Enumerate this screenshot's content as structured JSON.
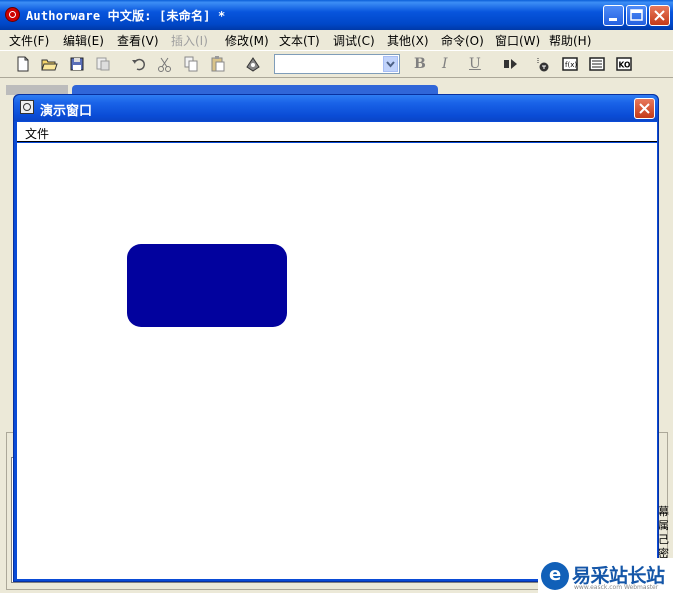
{
  "app": {
    "title": "Authorware 中文版: [未命名] *"
  },
  "menubar": {
    "items": [
      {
        "label": "文件(F)"
      },
      {
        "label": "编辑(E)"
      },
      {
        "label": "查看(V)"
      },
      {
        "label": "插入(I)",
        "disabled": true
      },
      {
        "label": "修改(M)"
      },
      {
        "label": "文本(T)"
      },
      {
        "label": "调试(C)"
      },
      {
        "label": "其他(X)"
      },
      {
        "label": "命令(O)"
      },
      {
        "label": "窗口(W)"
      },
      {
        "label": "帮助(H)"
      }
    ]
  },
  "toolbar": {
    "font_value": "",
    "bold": "B",
    "italic": "I",
    "underline": "U",
    "icons": [
      "new-file-icon",
      "open-folder-icon",
      "save-all-icon",
      "import-icon",
      "undo-icon",
      "cut-icon",
      "copy-icon",
      "paste-icon",
      "find-icon",
      "run-icon",
      "control-panel-icon",
      "functions-icon",
      "variables-icon",
      "knowledge-objects-icon"
    ]
  },
  "presentation": {
    "title": "演示窗口",
    "menu_file": "文件",
    "shape_color": "#02029e"
  },
  "background": {
    "side_text": "幕属己密性外"
  },
  "watermark": {
    "text": "易采站长站",
    "sub": "www.easck.com  Webmaster"
  }
}
